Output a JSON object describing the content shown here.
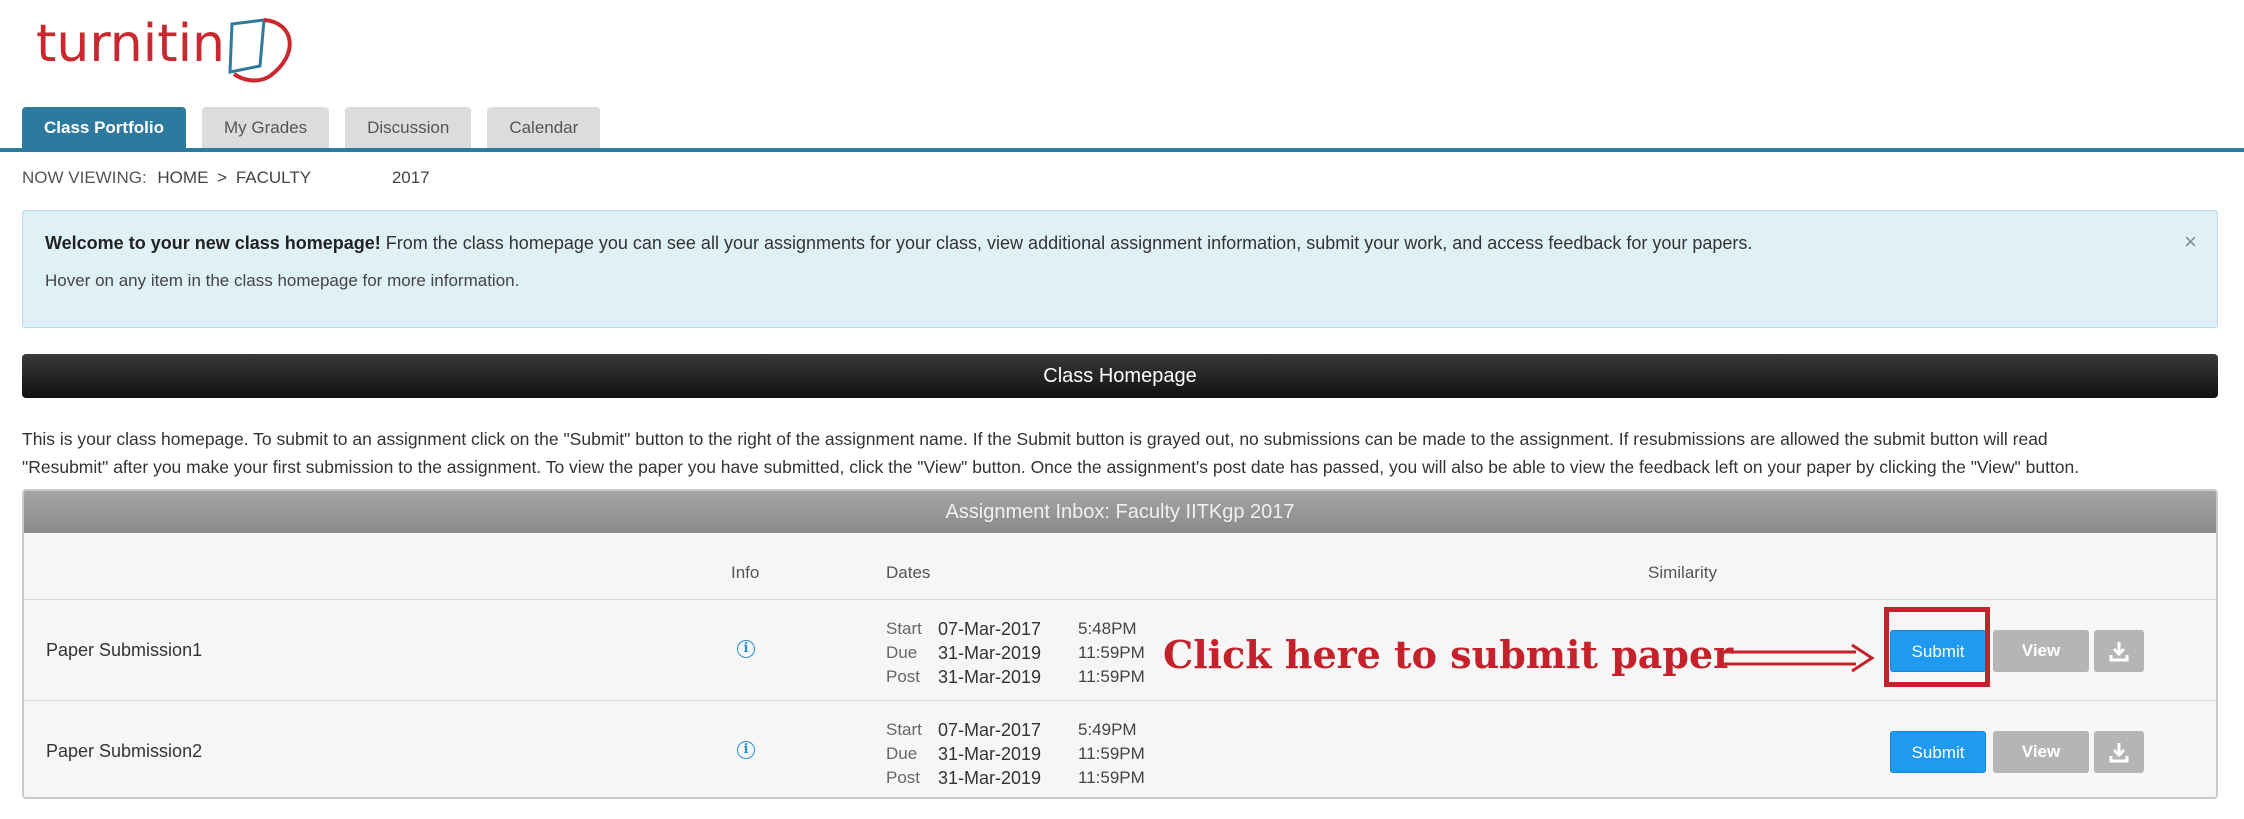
{
  "brand": {
    "name": "turnitin",
    "color": "#c8282e"
  },
  "tabs": [
    {
      "label": "Class Portfolio",
      "active": true
    },
    {
      "label": "My Grades",
      "active": false
    },
    {
      "label": "Discussion",
      "active": false
    },
    {
      "label": "Calendar",
      "active": false
    }
  ],
  "breadcrumb": {
    "label": "NOW VIEWING:",
    "home": "HOME",
    "sep": ">",
    "faculty": "FACULTY",
    "year": "2017"
  },
  "welcome": {
    "bold": "Welcome to your new class homepage!",
    "rest": " From the class homepage you can see all your assignments for your class, view additional assignment information, submit your work, and access feedback for your papers.",
    "line2": "Hover on any item in the class homepage for more information.",
    "close": "×"
  },
  "bar_title": "Class Homepage",
  "description": {
    "line1": "This is your class homepage. To submit to an assignment click on the \"Submit\" button to the right of the assignment name. If the Submit button is grayed out, no submissions can be made to the assignment. If resubmissions are allowed the submit button will read",
    "line2": "\"Resubmit\" after you make your first submission to the assignment. To view the paper you have submitted, click the \"View\" button. Once the assignment's post date has passed, you will also be able to view the feedback left on your paper by clicking the \"View\" button."
  },
  "inbox": {
    "title": "Assignment Inbox: Faculty IITKgp 2017",
    "columns": {
      "info": "Info",
      "dates": "Dates",
      "similarity": "Similarity"
    },
    "rows": [
      {
        "name": "Paper Submission1",
        "start_label": "Start",
        "start_date": "07-Mar-2017",
        "start_time": "5:48PM",
        "due_label": "Due",
        "due_date": "31-Mar-2019",
        "due_time": "11:59PM",
        "post_label": "Post",
        "post_date": "31-Mar-2019",
        "post_time": "11:59PM",
        "submit": "Submit",
        "view": "View"
      },
      {
        "name": "Paper Submission2",
        "start_label": "Start",
        "start_date": "07-Mar-2017",
        "start_time": "5:49PM",
        "due_label": "Due",
        "due_date": "31-Mar-2019",
        "due_time": "11:59PM",
        "post_label": "Post",
        "post_date": "31-Mar-2019",
        "post_time": "11:59PM",
        "submit": "Submit",
        "view": "View"
      }
    ]
  },
  "annotation": {
    "text": "Click here to submit paper",
    "color": "#c4212a"
  },
  "colors": {
    "tab_active": "#2e7a9e",
    "submit": "#1e9af0",
    "info_icon": "#2a8fd6"
  }
}
